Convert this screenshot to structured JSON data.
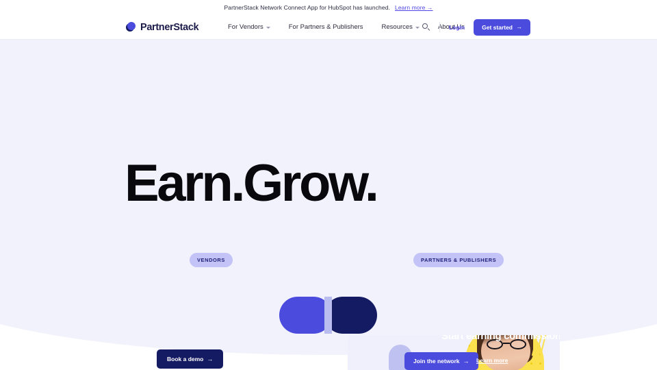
{
  "banner": {
    "text": "PartnerStack Network Connect App for HubSpot has launched.",
    "link_label": "Learn more →"
  },
  "nav": {
    "logo_text": "PartnerStack",
    "links": [
      {
        "label": "For Vendors",
        "has_chevron": true
      },
      {
        "label": "For Partners & Publishers",
        "has_chevron": false
      },
      {
        "label": "Resources",
        "has_chevron": true
      },
      {
        "label": "About Us",
        "has_chevron": false
      }
    ],
    "search_icon": "search-icon",
    "login_label": "Login",
    "cta_label": "Get started",
    "cta_arrow": "→"
  },
  "hero": {
    "title": "Earn.Grow.",
    "background_color": "#f2f2fd"
  },
  "pills": {
    "vendors": "VENDORS",
    "partners": "PARTNERS & PUBLISHERS"
  },
  "vendor_panel": {
    "demo_label": "Book a demo",
    "demo_arrow": "→"
  },
  "partner_panel": {
    "heading": "Start earning commissions.",
    "join_label": "Join the network",
    "join_arrow": "→",
    "learn_label": "Learn more"
  },
  "colors": {
    "indigo": "#4b4bde",
    "navy": "#141b63",
    "pill_bg": "#c3c3f7",
    "pill_text": "#20207a",
    "hero_bg": "#f2f2fd",
    "card_bg": "#eff0fb",
    "yellow": "#fbe14d"
  }
}
